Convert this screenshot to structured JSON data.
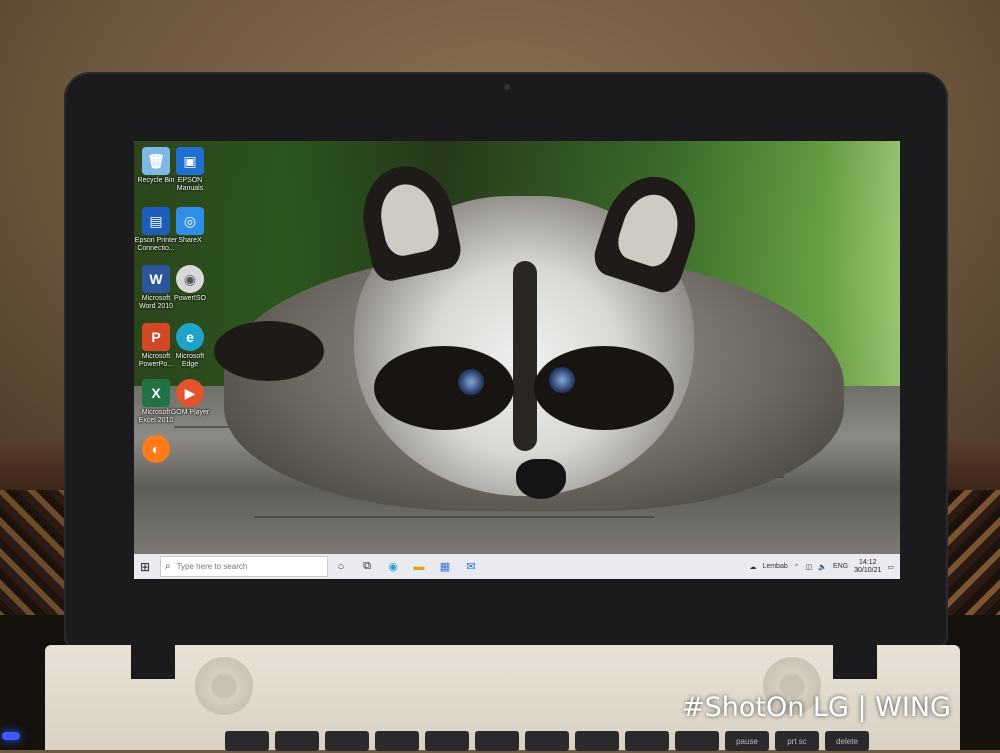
{
  "desktop": {
    "icons": [
      {
        "label": "Recycle Bin",
        "icon": "recycle-bin-icon",
        "color": "#7fb7e6",
        "glyph": "🗑"
      },
      {
        "label": "EPSON\nManuals",
        "icon": "epson-manuals-icon",
        "color": "#1f6fd1",
        "glyph": "▣"
      },
      {
        "label": "Epson Printer\nConnectio...",
        "icon": "epson-printer-icon",
        "color": "#1d5fb8",
        "glyph": "▤"
      },
      {
        "label": "ShareX",
        "icon": "sharex-icon",
        "color": "#2f8fe6",
        "glyph": "◎"
      },
      {
        "label": "Microsoft\nWord 2010",
        "icon": "word-icon",
        "color": "#2b579a",
        "glyph": "W"
      },
      {
        "label": "PowerISO",
        "icon": "poweriso-icon",
        "color": "#d8d8d8",
        "glyph": "◉"
      },
      {
        "label": "Microsoft\nPowerPo...",
        "icon": "powerpoint-icon",
        "color": "#d24726",
        "glyph": "P"
      },
      {
        "label": "Microsoft\nEdge",
        "icon": "edge-icon",
        "color": "#1fa3c8",
        "glyph": "e"
      },
      {
        "label": "Microsoft\nExcel 2010",
        "icon": "excel-icon",
        "color": "#217346",
        "glyph": "X"
      },
      {
        "label": "GOM Player",
        "icon": "gom-player-icon",
        "color": "#e2532e",
        "glyph": "▶"
      },
      {
        "label": "",
        "icon": "firefox-icon",
        "color": "#ff7a1a",
        "glyph": "◐"
      }
    ]
  },
  "taskbar": {
    "search_placeholder": "Type here to search",
    "weather": "Lembab",
    "language": "ENG",
    "time": "14:12",
    "date": "30/10/21"
  },
  "watermark": "#ShotOn LG | WING",
  "keyboard": {
    "keys": [
      "",
      "",
      "",
      "",
      "",
      "",
      "",
      "",
      "",
      "",
      "pause",
      "prt sc",
      "delete",
      ""
    ]
  }
}
